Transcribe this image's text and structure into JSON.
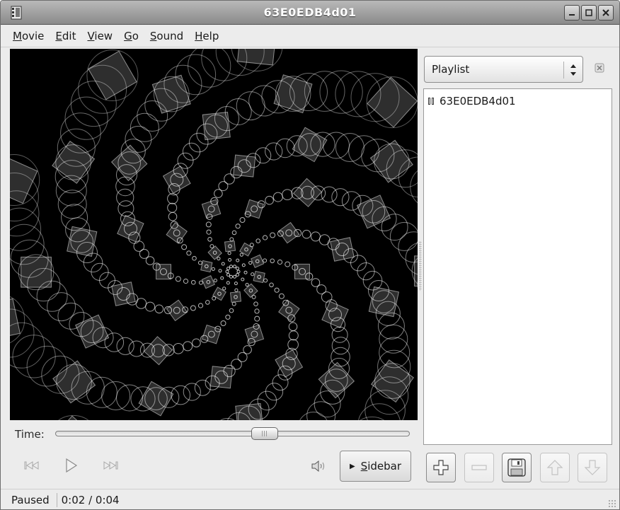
{
  "window": {
    "title": "63E0EDB4d01",
    "app_icon": "totem-film-icon",
    "controls": [
      "minimize-icon",
      "maximize-icon",
      "close-icon"
    ]
  },
  "menubar": {
    "items": [
      {
        "label": "Movie",
        "mnemonic": "M"
      },
      {
        "label": "Edit",
        "mnemonic": "E"
      },
      {
        "label": "View",
        "mnemonic": "V"
      },
      {
        "label": "Go",
        "mnemonic": "G"
      },
      {
        "label": "Sound",
        "mnemonic": "S"
      },
      {
        "label": "Help",
        "mnemonic": "H"
      }
    ]
  },
  "player": {
    "time_label": "Time:",
    "position_fraction": 0.62,
    "prev_icon": "skip-back-icon",
    "play_icon": "play-icon",
    "next_icon": "skip-forward-icon",
    "volume_icon": "speaker-icon",
    "sidebar_button_label": "Sidebar"
  },
  "sidebar": {
    "selector_value": "Playlist",
    "close_icon": "close-x-icon",
    "playlist_items": [
      {
        "title": "63E0EDB4d01",
        "state_icon": "pause-icon"
      }
    ],
    "buttons": [
      {
        "icon": "add-icon",
        "enabled": true
      },
      {
        "icon": "remove-icon",
        "enabled": false
      },
      {
        "icon": "save-icon",
        "enabled": true
      },
      {
        "icon": "move-up-icon",
        "enabled": false
      },
      {
        "icon": "move-down-icon",
        "enabled": false
      }
    ]
  },
  "status": {
    "state": "Paused",
    "time": "0:02 / 0:04"
  },
  "colors": {
    "titlebar": "#9c9c9c",
    "video_background": "#000000",
    "window_background": "#ececec"
  }
}
